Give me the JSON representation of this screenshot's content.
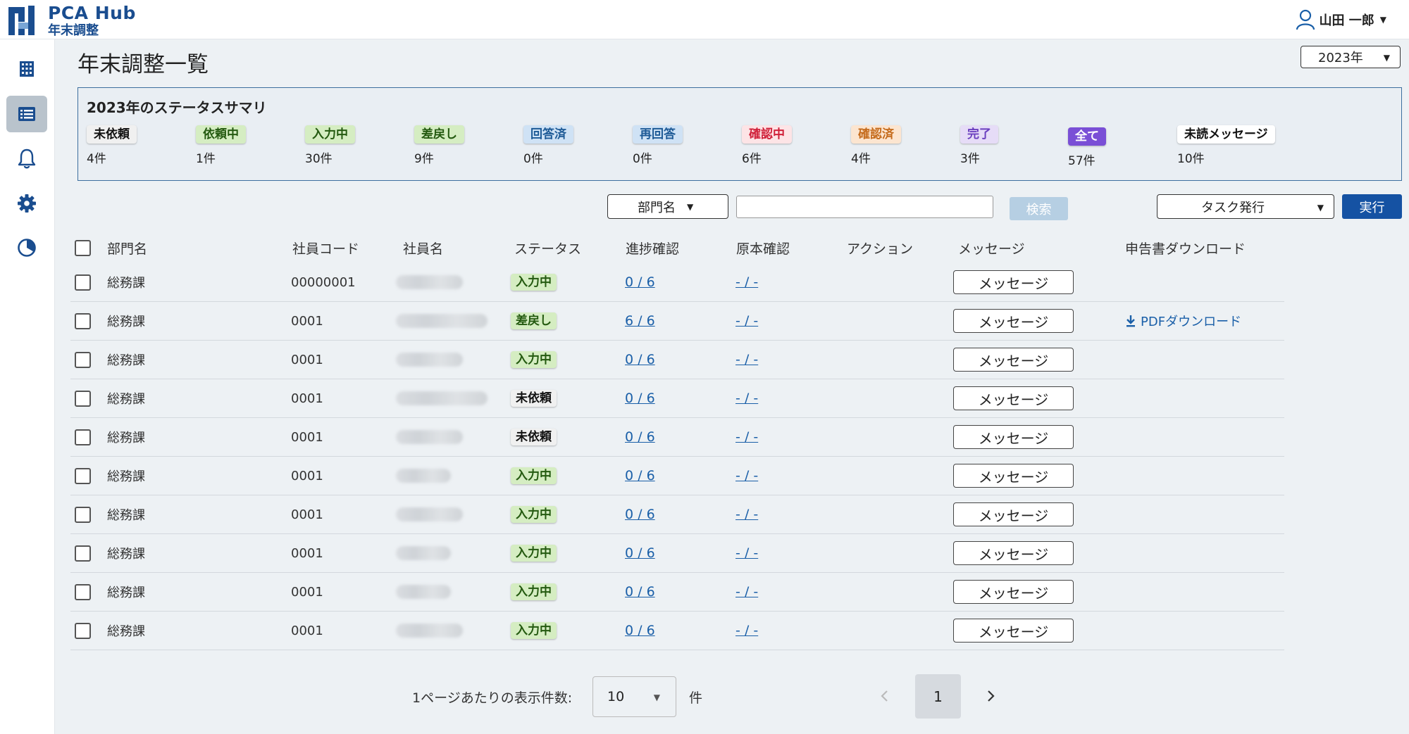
{
  "app": {
    "title": "PCA Hub",
    "subtitle": "年末調整"
  },
  "user": {
    "name": "山田 一郎"
  },
  "page": {
    "title": "年末調整一覧",
    "year_select": "2023年"
  },
  "summary": {
    "title": "2023年のステータスサマリ",
    "items": [
      {
        "label": "未依頼",
        "count": "4件"
      },
      {
        "label": "依頼中",
        "count": "1件"
      },
      {
        "label": "入力中",
        "count": "30件"
      },
      {
        "label": "差戻し",
        "count": "9件"
      },
      {
        "label": "回答済",
        "count": "0件"
      },
      {
        "label": "再回答",
        "count": "0件"
      },
      {
        "label": "確認中",
        "count": "6件"
      },
      {
        "label": "確認済",
        "count": "4件"
      },
      {
        "label": "完了",
        "count": "3件"
      },
      {
        "label": "全て",
        "count": "57件"
      },
      {
        "label": "未読メッセージ",
        "count": "10件"
      }
    ]
  },
  "filter": {
    "dept_select": "部門名",
    "search_placeholder": "",
    "search_button": "検索",
    "task_select": "タスク発行",
    "run_button": "実行"
  },
  "table": {
    "headers": {
      "dept": "部門名",
      "code": "社員コード",
      "name": "社員名",
      "status": "ステータス",
      "progress": "進捗確認",
      "original": "原本確認",
      "action": "アクション",
      "message": "メッセージ",
      "download": "申告書ダウンロード"
    },
    "rows": [
      {
        "dept": "総務課",
        "code": "00000001",
        "status": "入力中",
        "progress": "0 / 6",
        "original": "- / -",
        "message": "メッセージ",
        "download": ""
      },
      {
        "dept": "総務課",
        "code": "0001",
        "status": "差戻し",
        "progress": "6 / 6",
        "original": "- / -",
        "message": "メッセージ",
        "download": "PDFダウンロード"
      },
      {
        "dept": "総務課",
        "code": "0001",
        "status": "入力中",
        "progress": "0 / 6",
        "original": "- / -",
        "message": "メッセージ",
        "download": ""
      },
      {
        "dept": "総務課",
        "code": "0001",
        "status": "未依頼",
        "progress": "0 / 6",
        "original": "- / -",
        "message": "メッセージ",
        "download": ""
      },
      {
        "dept": "総務課",
        "code": "0001",
        "status": "未依頼",
        "progress": "0 / 6",
        "original": "- / -",
        "message": "メッセージ",
        "download": ""
      },
      {
        "dept": "総務課",
        "code": "0001",
        "status": "入力中",
        "progress": "0 / 6",
        "original": "- / -",
        "message": "メッセージ",
        "download": ""
      },
      {
        "dept": "総務課",
        "code": "0001",
        "status": "入力中",
        "progress": "0 / 6",
        "original": "- / -",
        "message": "メッセージ",
        "download": ""
      },
      {
        "dept": "総務課",
        "code": "0001",
        "status": "入力中",
        "progress": "0 / 6",
        "original": "- / -",
        "message": "メッセージ",
        "download": ""
      },
      {
        "dept": "総務課",
        "code": "0001",
        "status": "入力中",
        "progress": "0 / 6",
        "original": "- / -",
        "message": "メッセージ",
        "download": ""
      },
      {
        "dept": "総務課",
        "code": "0001",
        "status": "入力中",
        "progress": "0 / 6",
        "original": "- / -",
        "message": "メッセージ",
        "download": ""
      }
    ]
  },
  "pagination": {
    "per_page_label": "1ページあたりの表示件数:",
    "per_page_value": "10",
    "per_page_unit": "件",
    "current_page": "1"
  },
  "colors": {
    "brand": "#1a4d8f",
    "primary_button": "#1552a3",
    "link": "#1a5fa8"
  },
  "icons": {
    "sidebar": [
      "building-icon",
      "list-icon",
      "bell-icon",
      "gear-icon",
      "chart-pie-icon"
    ]
  }
}
